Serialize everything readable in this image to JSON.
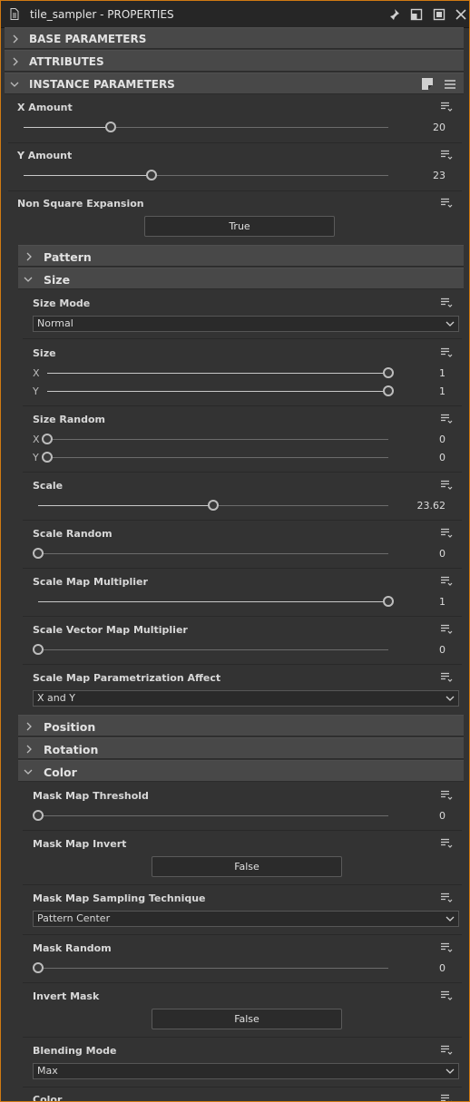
{
  "window": {
    "title": "tile_sampler - PROPERTIES"
  },
  "sections": {
    "base": "BASE PARAMETERS",
    "attributes": "ATTRIBUTES",
    "instance": "INSTANCE PARAMETERS"
  },
  "params": {
    "x_amount": {
      "label": "X Amount",
      "value": "20",
      "fraction": 0.24
    },
    "y_amount": {
      "label": "Y Amount",
      "value": "23",
      "fraction": 0.35
    },
    "non_square": {
      "label": "Non Square Expansion",
      "button": "True"
    }
  },
  "groups": {
    "pattern": "Pattern",
    "size": "Size",
    "position": "Position",
    "rotation": "Rotation",
    "color": "Color"
  },
  "size_group": {
    "size_mode": {
      "label": "Size Mode",
      "value": "Normal"
    },
    "size": {
      "label": "Size",
      "x_label": "X",
      "y_label": "Y",
      "x": "1",
      "y": "1"
    },
    "size_random": {
      "label": "Size Random",
      "x_label": "X",
      "y_label": "Y",
      "x": "0",
      "y": "0"
    },
    "scale": {
      "label": "Scale",
      "value": "23.62",
      "fraction": 0.5
    },
    "scale_random": {
      "label": "Scale Random",
      "value": "0"
    },
    "scale_map_multiplier": {
      "label": "Scale Map Multiplier",
      "value": "1"
    },
    "scale_vector_map_multiplier": {
      "label": "Scale Vector Map Multiplier",
      "value": "0"
    },
    "scale_map_param_affect": {
      "label": "Scale Map Parametrization Affect",
      "value": "X and Y"
    }
  },
  "color_group": {
    "mask_map_threshold": {
      "label": "Mask Map Threshold",
      "value": "0"
    },
    "mask_map_invert": {
      "label": "Mask Map Invert",
      "button": "False"
    },
    "mask_map_sampling": {
      "label": "Mask Map Sampling Technique",
      "value": "Pattern Center"
    },
    "mask_random": {
      "label": "Mask Random",
      "value": "0"
    },
    "invert_mask": {
      "label": "Invert Mask",
      "button": "False"
    },
    "blending_mode": {
      "label": "Blending Mode",
      "value": "Max"
    },
    "color": {
      "label": "Color"
    }
  }
}
